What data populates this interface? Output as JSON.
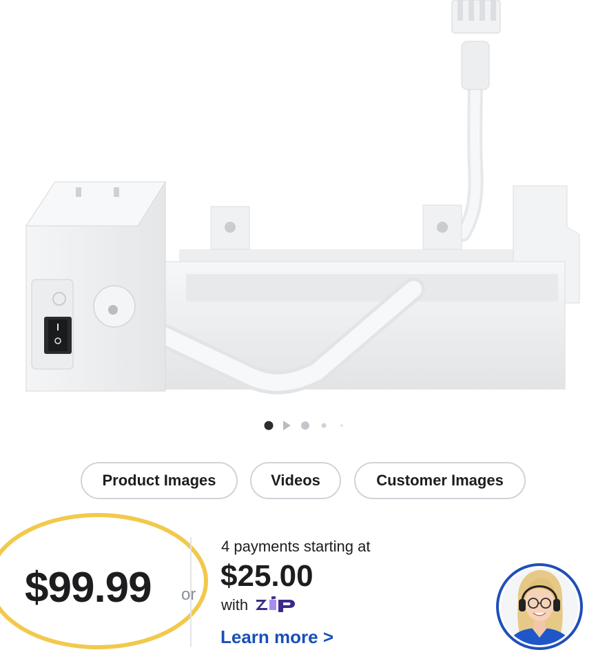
{
  "media_tabs": [
    {
      "label": "Product Images"
    },
    {
      "label": "Videos"
    },
    {
      "label": "Customer Images"
    }
  ],
  "carousel": {
    "total_indicators": 5,
    "active_index": 0
  },
  "pricing": {
    "price": "$99.99",
    "or_label": "or",
    "installments_label": "4 payments starting at",
    "installment_amount": "$25.00",
    "with_label": "with",
    "provider_logo_text": "zip",
    "learn_more": "Learn more >"
  },
  "colors": {
    "highlight_circle": "#f2c94c",
    "link": "#1a4fb6",
    "zip_purple": "#3b2a8c",
    "zip_accent": "#a98cf0",
    "avatar_ring": "#1f4fb8"
  },
  "icons": {
    "avatar": "support-agent-avatar",
    "video_dot": "play-triangle-icon"
  }
}
